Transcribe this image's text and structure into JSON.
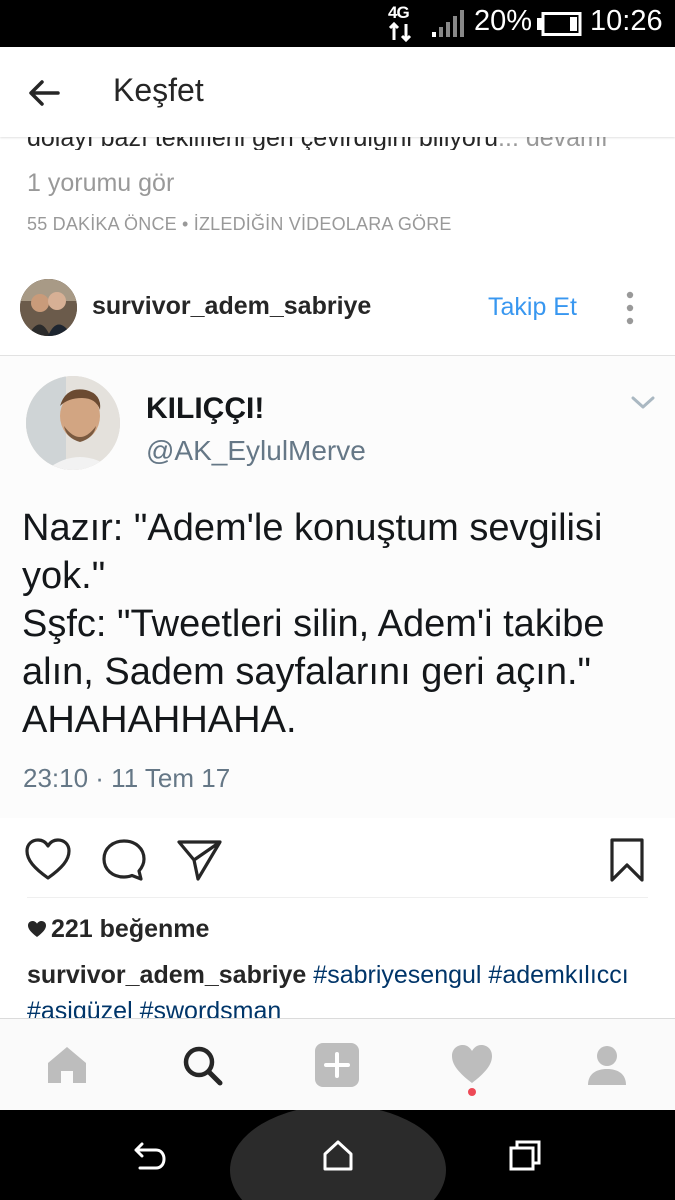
{
  "status_bar": {
    "network": "4G",
    "battery_percent": "20%",
    "time": "10:26"
  },
  "header": {
    "title": "Keşfet"
  },
  "previous_post": {
    "caption_fragment": "dolayı bazı tekliflerii geri çevirdiğini biliyoru",
    "more_label": "... devamı",
    "comments_link": "1 yorumu gör",
    "timestamp": "55 DAKİKA ÖNCE • İZLEDİĞİN VİDEOLARA GÖRE"
  },
  "post": {
    "username": "survivor_adem_sabriye",
    "follow_label": "Takip Et",
    "tweet": {
      "display_name": "KILIÇÇI!",
      "handle": "@AK_EylulMerve",
      "text": "Nazır: \"Adem'le konuştum sevgilisi yok.\"\nSşfc: \"Tweetleri silin, Adem'i takibe alın, Sadem sayfalarını geri açın.\"\nAHAHAHHAHA.",
      "date": "23:10 · 11 Tem 17"
    },
    "likes": "221 beğenme",
    "caption": {
      "username": "survivor_adem_sabriye",
      "hashtags": [
        "#sabriyesengul",
        "#ademkılıccı",
        "#asigüzel",
        "#swordsman"
      ]
    }
  },
  "colors": {
    "link_blue": "#3897f0",
    "hashtag": "#003569",
    "muted": "#999999",
    "notification_dot": "#ed4956"
  },
  "icons": {
    "actions": [
      "heart-icon",
      "comment-icon",
      "share-icon",
      "bookmark-icon"
    ],
    "bottom_nav": [
      "home-icon",
      "search-icon",
      "add-icon",
      "activity-heart-icon",
      "profile-icon"
    ],
    "system_nav": [
      "back-icon",
      "home-outline-icon",
      "recent-apps-icon"
    ]
  }
}
